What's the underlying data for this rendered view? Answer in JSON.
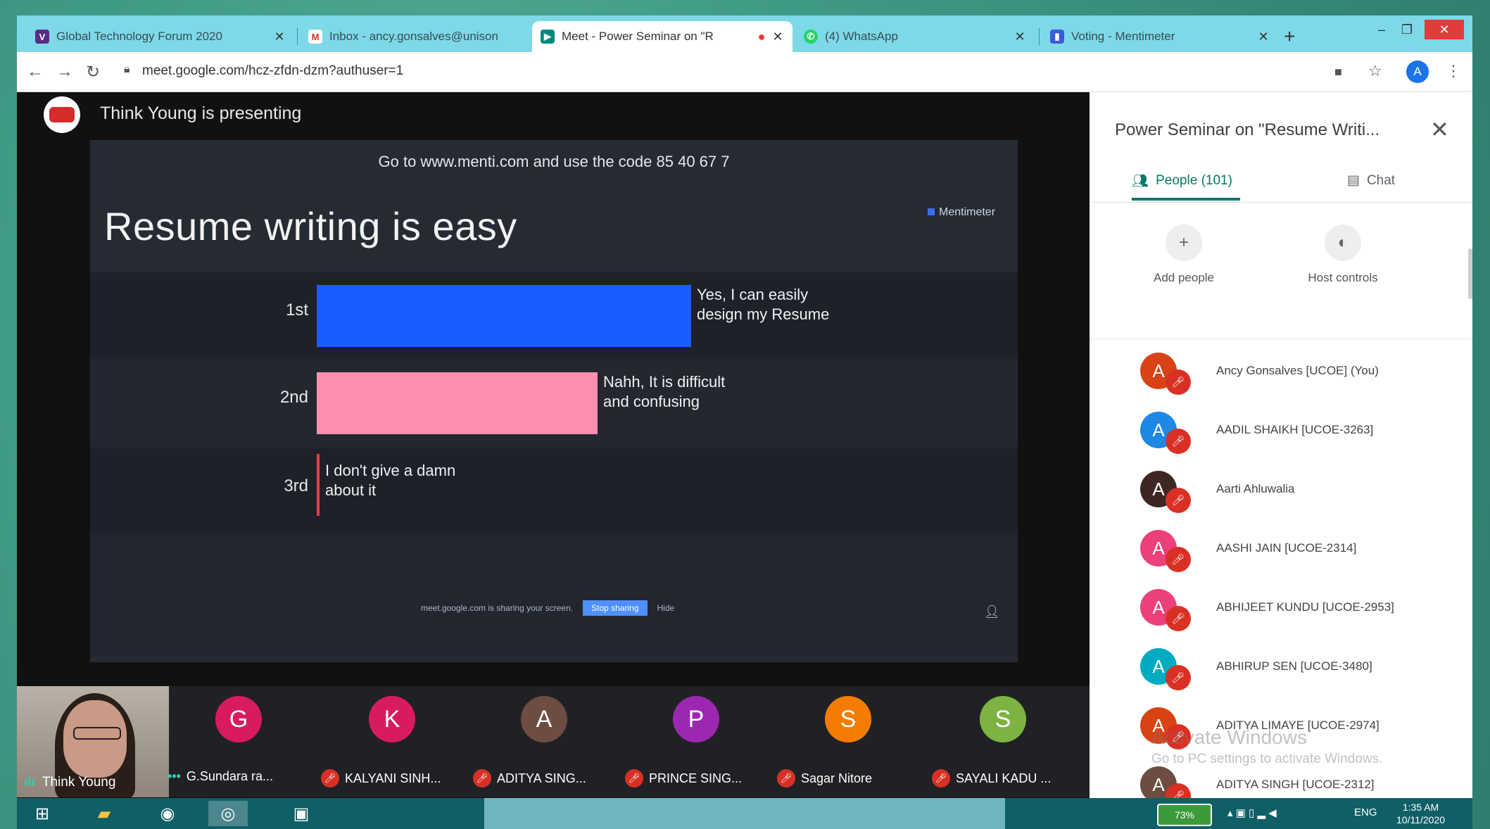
{
  "browser": {
    "tabs": [
      {
        "title": "Global Technology Forum 2020",
        "fav_color": "#5b2a86",
        "fav_glyph": "V"
      },
      {
        "title": "Inbox - ancy.gonsalves@unison",
        "fav_color": "#ffffff",
        "fav_glyph": "M"
      },
      {
        "title": "Meet - Power Seminar on \"R",
        "fav_color": "#00897b",
        "fav_glyph": "▶"
      },
      {
        "title": "(4) WhatsApp",
        "fav_color": "#25d366",
        "fav_glyph": "✆"
      },
      {
        "title": "Voting - Mentimeter",
        "fav_color": "#3b5bdb",
        "fav_glyph": "▮"
      }
    ],
    "close_glyph": "✕",
    "new_tab_glyph": "+",
    "url": "meet.google.com/hcz-zfdn-dzm?authuser=1",
    "profile_initial": "A"
  },
  "meet": {
    "presenter_text": "Think Young is presenting",
    "slide": {
      "code_text": "Go to www.menti.com and use the code 85 40 67 7",
      "title": "Resume writing is easy",
      "brand": "Mentimeter",
      "stop_sharing": "Stop sharing",
      "hide": "Hide",
      "sharing_notice": "meet.google.com is sharing your screen."
    },
    "chart_data": {
      "type": "bar",
      "categories": [
        "1st",
        "2nd",
        "3rd"
      ],
      "labels": [
        "Yes, I can easily design my Resume",
        "Nahh, It is difficult and confusing",
        "I don't give a damn about it"
      ],
      "values": [
        48,
        36,
        0
      ],
      "colors": [
        "#1a5cff",
        "#ff8fb1",
        "#e04040"
      ]
    },
    "self": {
      "name": "Think Young"
    },
    "participants": [
      {
        "initial": "G",
        "name": "G.Sundara ra...",
        "color": "#d81b60",
        "muted": false
      },
      {
        "initial": "K",
        "name": "KALYANI SINH...",
        "color": "#d81b60",
        "muted": true
      },
      {
        "initial": "A",
        "name": "ADITYA SING...",
        "color": "#6d4c41",
        "muted": true
      },
      {
        "initial": "P",
        "name": "PRINCE SING...",
        "color": "#9c27b0",
        "muted": true
      },
      {
        "initial": "S",
        "name": "Sagar Nitore",
        "color": "#f57c00",
        "muted": true
      },
      {
        "initial": "S",
        "name": "SAYALI KADU ...",
        "color": "#7cb342",
        "muted": true
      }
    ]
  },
  "panel": {
    "title": "Power Seminar on \"Resume Writi...",
    "tab_people": "People (101)",
    "tab_chat": "Chat",
    "add_people": "Add people",
    "host_controls": "Host controls",
    "people": [
      {
        "initial": "A",
        "name": "Ancy Gonsalves [UCOE] (You)",
        "color": "#d84315"
      },
      {
        "initial": "A",
        "name": "AADIL SHAIKH [UCOE-3263]",
        "color": "#1e88e5"
      },
      {
        "initial": "A",
        "name": "Aarti Ahluwalia",
        "color": "#3e2723"
      },
      {
        "initial": "A",
        "name": "AASHI JAIN [UCOE-2314]",
        "color": "#ec407a"
      },
      {
        "initial": "A",
        "name": "ABHIJEET KUNDU [UCOE-2953]",
        "color": "#ec407a"
      },
      {
        "initial": "A",
        "name": "ABHIRUP SEN [UCOE-3480]",
        "color": "#00acc1"
      },
      {
        "initial": "A",
        "name": "ADITYA LIMAYE [UCOE-2974]",
        "color": "#d84315"
      },
      {
        "initial": "A",
        "name": "ADITYA SINGH [UCOE-2312]",
        "color": "#6d4c41"
      }
    ],
    "watermark_title": "Activate Windows",
    "watermark_sub": "Go to PC settings to activate Windows."
  },
  "taskbar": {
    "battery": "73%",
    "lang": "ENG",
    "time": "1:35 AM",
    "date": "10/11/2020"
  }
}
